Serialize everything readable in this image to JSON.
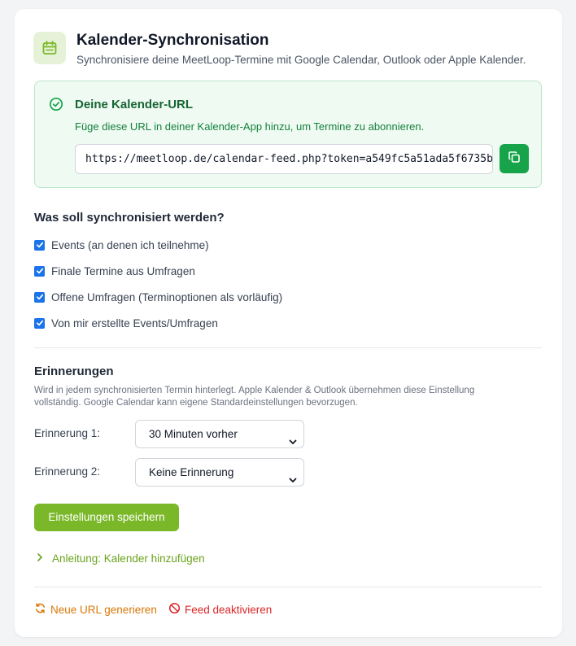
{
  "header": {
    "title": "Kalender-Synchronisation",
    "subtitle": "Synchronisiere deine MeetLoop-Termine mit Google Calendar, Outlook oder Apple Kalender.",
    "icon": "calendar-icon"
  },
  "url_section": {
    "title": "Deine Kalender-URL",
    "description": "Füge diese URL in deiner Kalender-App hinzu, um Termine zu abonnieren.",
    "url": "https://meetloop.de/calendar-feed.php?token=a549fc5a51ada5f6735b",
    "copy_icon": "copy-icon",
    "accent": "#16a34a"
  },
  "sync": {
    "title": "Was soll synchronisiert werden?",
    "options": [
      {
        "label": "Events (an denen ich teilnehme)",
        "checked": true
      },
      {
        "label": "Finale Termine aus Umfragen",
        "checked": true
      },
      {
        "label": "Offene Umfragen (Terminoptionen als vorläufig)",
        "checked": true
      },
      {
        "label": "Von mir erstellte Events/Umfragen",
        "checked": true
      }
    ]
  },
  "reminders": {
    "title": "Erinnerungen",
    "description": "Wird in jedem synchronisierten Termin hinterlegt. Apple Kalender & Outlook übernehmen diese Einstellung vollständig. Google Calendar kann eigene Standardeinstellungen bevorzugen.",
    "reminder1": {
      "label": "Erinnerung 1:",
      "value": "30 Minuten vorher"
    },
    "reminder2": {
      "label": "Erinnerung 2:",
      "value": "Keine Erinnerung"
    }
  },
  "actions": {
    "save_label": "Einstellungen speichern",
    "save_color": "#7ab829",
    "guide_label": "Anleitung: Kalender hinzufügen",
    "regenerate_label": "Neue URL generieren",
    "regenerate_color": "#d97706",
    "deactivate_label": "Feed deaktivieren",
    "deactivate_color": "#dc2626"
  }
}
